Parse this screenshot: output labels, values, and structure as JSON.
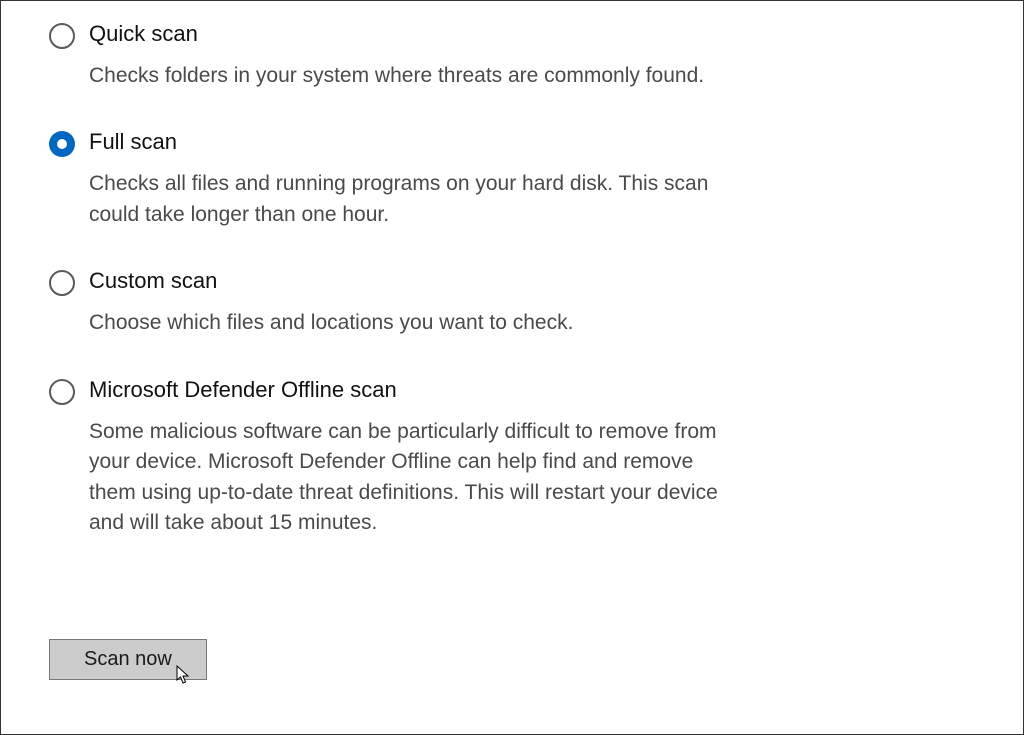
{
  "scan_options": [
    {
      "id": "quick",
      "title": "Quick scan",
      "description": "Checks folders in your system where threats are commonly found.",
      "selected": false
    },
    {
      "id": "full",
      "title": "Full scan",
      "description": "Checks all files and running programs on your hard disk. This scan could take longer than one hour.",
      "selected": true
    },
    {
      "id": "custom",
      "title": "Custom scan",
      "description": "Choose which files and locations you want to check.",
      "selected": false
    },
    {
      "id": "offline",
      "title": "Microsoft Defender Offline scan",
      "description": "Some malicious software can be particularly difficult to remove from your device. Microsoft Defender Offline can help find and remove them using up-to-date threat definitions. This will restart your device and will take about 15 minutes.",
      "selected": false
    }
  ],
  "actions": {
    "scan_now_label": "Scan now"
  },
  "colors": {
    "accent": "#0067c0"
  }
}
